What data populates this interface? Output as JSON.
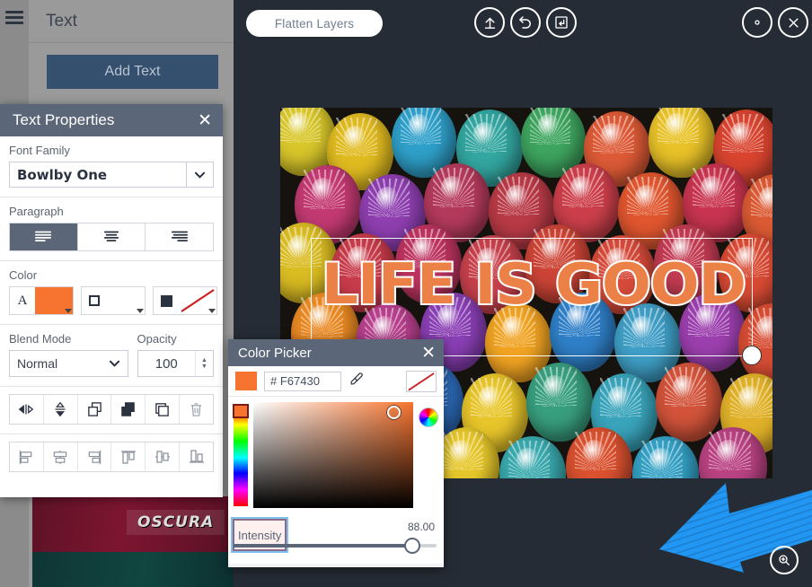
{
  "app": {
    "left_panel": {
      "title": "Text",
      "add_text_label": "Add Text",
      "menu_icon": "hamburger-menu-icon",
      "thumbnail_text": "OSCURA"
    },
    "toolbar": {
      "flatten_label": "Flatten Layers",
      "icons": {
        "upload": "upload-icon",
        "undo": "undo-icon",
        "save": "save-download-icon",
        "settings": "gear-icon",
        "close": "close-icon",
        "zoom": "zoom-in-icon"
      }
    },
    "canvas": {
      "text_layer": "LIFE IS GOOD",
      "text_color": "#ec8148",
      "outline_color": "#ffffff",
      "annotation": "blue-arrow-annotation"
    }
  },
  "text_properties": {
    "title": "Text Properties",
    "close_label": "✕",
    "font_family_label": "Font Family",
    "font_family_value": "Bowlby One",
    "paragraph_label": "Paragraph",
    "paragraph_options": [
      {
        "name": "align-left",
        "selected": true
      },
      {
        "name": "align-center",
        "selected": false
      },
      {
        "name": "align-right",
        "selected": false
      }
    ],
    "color_label": "Color",
    "color_swatches": [
      {
        "name": "fill-color",
        "icon": "letter-a-icon",
        "value": "#f67430"
      },
      {
        "name": "stroke-color",
        "icon": "outline-square-icon",
        "value": "#ffffff"
      },
      {
        "name": "shadow-color",
        "icon": "filled-square-icon",
        "value": "none"
      }
    ],
    "blend_mode_label": "Blend Mode",
    "blend_mode_value": "Normal",
    "opacity_label": "Opacity",
    "opacity_value": "100",
    "layer_tools": [
      "flip-horizontal-icon",
      "flip-vertical-icon",
      "bring-forward-icon",
      "send-backward-icon",
      "duplicate-icon",
      "delete-trash-icon"
    ],
    "align_tools": [
      "align-left-icon",
      "align-center-horizontal-icon",
      "align-right-icon",
      "align-top-icon",
      "align-center-vertical-icon",
      "align-bottom-icon"
    ]
  },
  "color_picker": {
    "title": "Color Picker",
    "close_label": "✕",
    "hex_value": "# F67430",
    "current_color": "#f67430",
    "eyedropper_icon": "eyedropper-icon",
    "no_color_icon": "no-color-icon",
    "wheel_icon": "color-wheel-icon",
    "intensity_label": "Intensity",
    "intensity_value": "88.00"
  }
}
